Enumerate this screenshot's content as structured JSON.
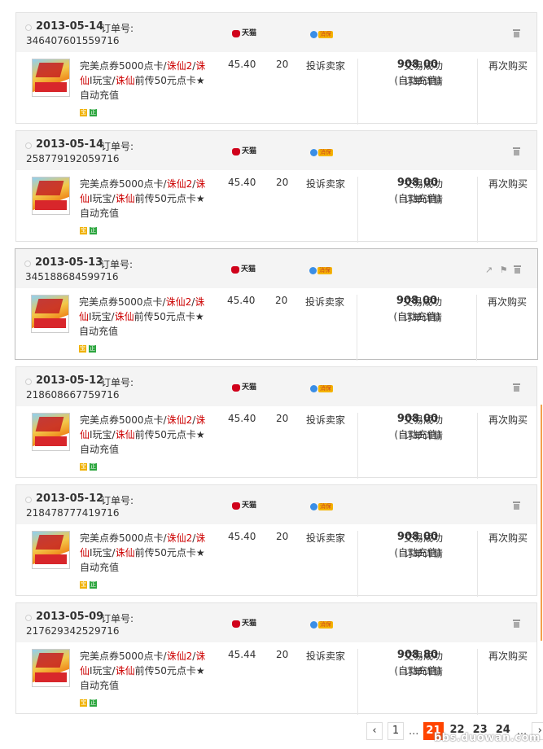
{
  "orders": [
    {
      "date": "2013-05-14",
      "order_label": "订单号:",
      "order_no": "346407601559716",
      "title_a": "完美点券5000点卡/",
      "title_b": "诛仙2",
      "title_c": "/",
      "title_d": "诛",
      "title_e": "仙",
      "title_f": "I玩宝/",
      "title_g": "诛仙",
      "title_h": "前传50元点卡★",
      "title_i": "自动充值",
      "price": "45.40",
      "qty": "20",
      "complain": "投诉卖家",
      "amount": "908.00",
      "amount_sub": "(自动充值)",
      "status": "交易成功",
      "detail": "订单详情",
      "rebuy": "再次购买",
      "tmall": "天猫",
      "protect": "消保",
      "badge_y": "宝",
      "badge_g": "正"
    },
    {
      "date": "2013-05-14",
      "order_label": "订单号:",
      "order_no": "258779192059716",
      "title_a": "完美点券5000点卡/",
      "title_b": "诛仙2",
      "title_c": "/",
      "title_d": "诛",
      "title_e": "仙",
      "title_f": "I玩宝/",
      "title_g": "诛仙",
      "title_h": "前传50元点卡★",
      "title_i": "自动充值",
      "price": "45.40",
      "qty": "20",
      "complain": "投诉卖家",
      "amount": "908.00",
      "amount_sub": "(自动充值)",
      "status": "交易成功",
      "detail": "订单详情",
      "rebuy": "再次购买",
      "tmall": "天猫",
      "protect": "消保",
      "badge_y": "宝",
      "badge_g": "正"
    },
    {
      "date": "2013-05-13",
      "order_label": "订单号:",
      "order_no": "345188684599716",
      "title_a": "完美点券5000点卡/",
      "title_b": "诛仙2",
      "title_c": "/",
      "title_d": "诛",
      "title_e": "仙",
      "title_f": "I玩宝/",
      "title_g": "诛仙",
      "title_h": "前传50元点卡★",
      "title_i": "自动充值",
      "price": "45.40",
      "qty": "20",
      "complain": "投诉卖家",
      "amount": "908.00",
      "amount_sub": "(自动充值)",
      "status": "交易成功",
      "detail": "订单详情",
      "rebuy": "再次购买",
      "tmall": "天猫",
      "protect": "消保",
      "badge_y": "宝",
      "badge_g": "正"
    },
    {
      "date": "2013-05-12",
      "order_label": "订单号:",
      "order_no": "218608667759716",
      "title_a": "完美点券5000点卡/",
      "title_b": "诛仙2",
      "title_c": "/",
      "title_d": "诛",
      "title_e": "仙",
      "title_f": "I玩宝/",
      "title_g": "诛仙",
      "title_h": "前传50元点卡★",
      "title_i": "自动充值",
      "price": "45.40",
      "qty": "20",
      "complain": "投诉卖家",
      "amount": "908.00",
      "amount_sub": "(自动充值)",
      "status": "交易成功",
      "detail": "订单详情",
      "rebuy": "再次购买",
      "tmall": "天猫",
      "protect": "消保",
      "badge_y": "宝",
      "badge_g": "正"
    },
    {
      "date": "2013-05-12",
      "order_label": "订单号:",
      "order_no": "218478777419716",
      "title_a": "完美点券5000点卡/",
      "title_b": "诛仙2",
      "title_c": "/",
      "title_d": "诛",
      "title_e": "仙",
      "title_f": "I玩宝/",
      "title_g": "诛仙",
      "title_h": "前传50元点卡★",
      "title_i": "自动充值",
      "price": "45.40",
      "qty": "20",
      "complain": "投诉卖家",
      "amount": "908.00",
      "amount_sub": "(自动充值)",
      "status": "交易成功",
      "detail": "订单详情",
      "rebuy": "再次购买",
      "tmall": "天猫",
      "protect": "消保",
      "badge_y": "宝",
      "badge_g": "正"
    },
    {
      "date": "2013-05-09",
      "order_label": "订单号:",
      "order_no": "217629342529716",
      "title_a": "完美点券5000点卡/",
      "title_b": "诛仙2",
      "title_c": "/",
      "title_d": "诛",
      "title_e": "仙",
      "title_f": "I玩宝/",
      "title_g": "诛仙",
      "title_h": "前传50元点卡★",
      "title_i": "自动充值",
      "price": "45.44",
      "qty": "20",
      "complain": "投诉卖家",
      "amount": "908.80",
      "amount_sub": "(自动充值)",
      "status": "交易成功",
      "detail": "订单详情",
      "rebuy": "再次购买",
      "tmall": "天猫",
      "protect": "消保",
      "badge_y": "宝",
      "badge_g": "正"
    }
  ],
  "pager": {
    "prev": "‹",
    "p1": "1",
    "ellipsis1": "...",
    "p21": "21",
    "p22": "22",
    "p23": "23",
    "p24": "24",
    "ellipsis2": "...",
    "next": "›"
  },
  "watermark": "bbs.duowan.com",
  "icons": {
    "trash": "trash-icon",
    "share": "share-icon",
    "flag": "flag-icon"
  }
}
